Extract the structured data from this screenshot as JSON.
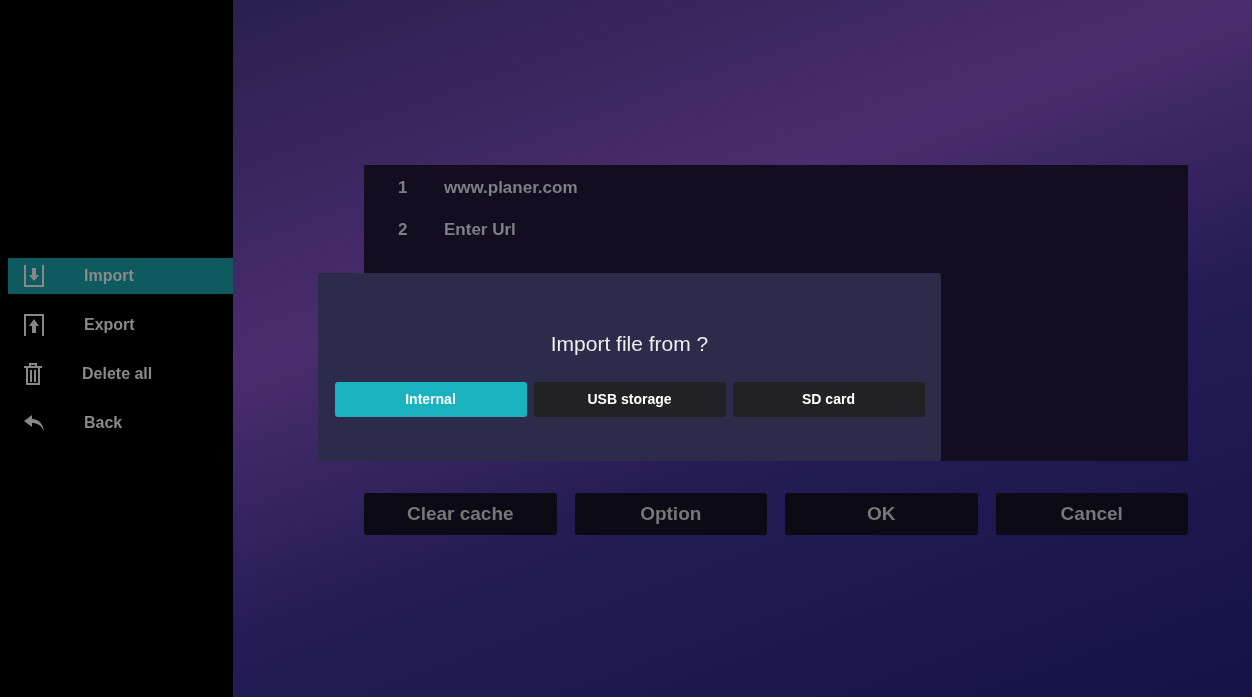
{
  "sidebar": {
    "items": [
      {
        "kind": "import",
        "label": "Import",
        "selected": true
      },
      {
        "kind": "export",
        "label": "Export",
        "selected": false
      },
      {
        "kind": "delete",
        "label": "Delete all",
        "selected": false
      },
      {
        "kind": "back",
        "label": "Back",
        "selected": false
      }
    ]
  },
  "url_list": [
    {
      "number": "1",
      "url": "www.planer.com"
    },
    {
      "number": "2",
      "url": "Enter Url"
    }
  ],
  "buttons": [
    "Clear cache",
    "Option",
    "OK",
    "Cancel"
  ],
  "dialog": {
    "title": "Import file from ?",
    "options": [
      {
        "label": "Internal",
        "selected": true
      },
      {
        "label": "USB storage",
        "selected": false
      },
      {
        "label": "SD card",
        "selected": false
      }
    ]
  }
}
